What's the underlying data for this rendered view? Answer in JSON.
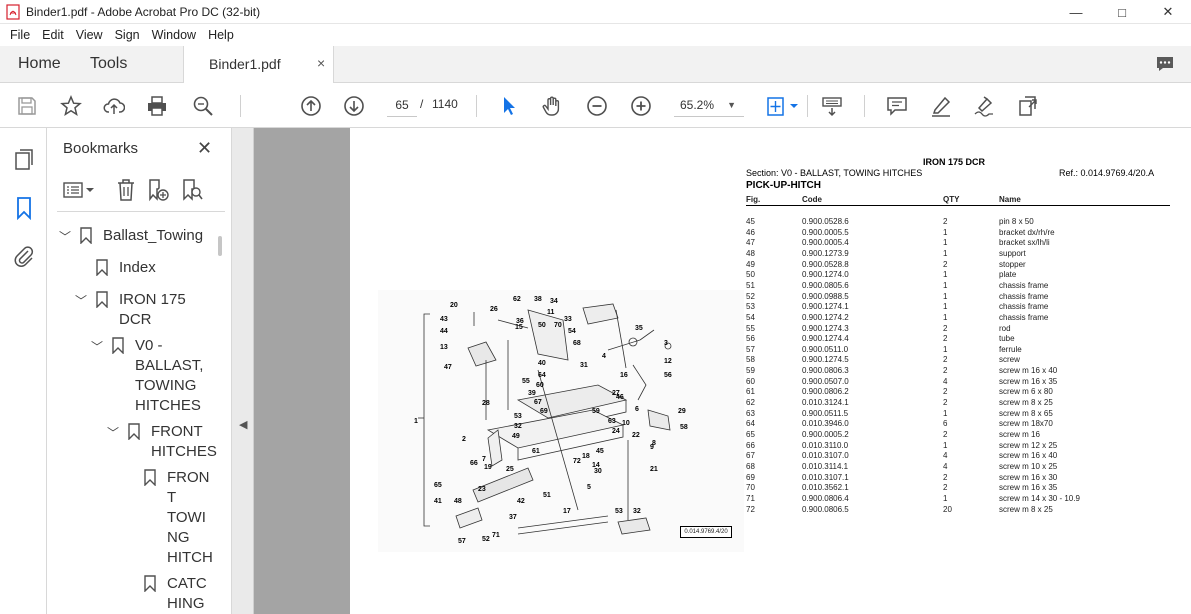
{
  "window": {
    "title": "Binder1.pdf - Adobe Acrobat Pro DC (32-bit)",
    "controls": [
      "—",
      "□",
      "✕"
    ]
  },
  "menu": [
    "File",
    "Edit",
    "View",
    "Sign",
    "Window",
    "Help"
  ],
  "tabs": {
    "home": "Home",
    "tools": "Tools",
    "document": "Binder1.pdf",
    "close": "×"
  },
  "toolbar": {
    "page_current": "65",
    "page_separator": "/",
    "page_total": "1140",
    "zoom": "65.2%"
  },
  "bookmarks": {
    "title": "Bookmarks",
    "close": "✕",
    "items": [
      {
        "label": "Ballast_Towing"
      },
      {
        "label": "Index"
      },
      {
        "label": "IRON 175 DCR"
      },
      {
        "label": "V0 - BALLAST, TOWING HITCHES"
      },
      {
        "label": "FRONT HITCHES"
      },
      {
        "label": "FRONT TOWING HITCH"
      },
      {
        "label": "CATCHING"
      }
    ],
    "lines": {
      "ballast": "Ballast_Towing",
      "index": "Index",
      "iron1": "IRON 175",
      "iron2": "DCR",
      "v0_1": "V0 -",
      "v0_2": "BALLAST,",
      "v0_3": "TOWING",
      "v0_4": "HITCHES",
      "front1": "FRONT",
      "front2": "HITCHES",
      "ft1": "FRON",
      "ft2": "T",
      "ft3": "TOWI",
      "ft4": "NG",
      "ft5": "HITCH",
      "c1": "CATC",
      "c2": "HING"
    }
  },
  "document": {
    "model": "IRON 175 DCR",
    "section": "Section: V0 - BALLAST, TOWING HITCHES",
    "ref": "Ref.: 0.014.9769.4/20.A",
    "heading": "PICK-UP-HITCH",
    "columns": {
      "fig": "Fig.",
      "code": "Code",
      "qty": "QTY",
      "name": "Name"
    },
    "parts": [
      {
        "fig": "45",
        "code": "0.900.0528.6",
        "qty": "2",
        "name": "pin 8 x 50"
      },
      {
        "fig": "46",
        "code": "0.900.0005.5",
        "qty": "1",
        "name": "bracket dx/rh/re"
      },
      {
        "fig": "47",
        "code": "0.900.0005.4",
        "qty": "1",
        "name": "bracket sx/lh/li"
      },
      {
        "fig": "48",
        "code": "0.900.1273.9",
        "qty": "1",
        "name": "support"
      },
      {
        "fig": "49",
        "code": "0.900.0528.8",
        "qty": "2",
        "name": "stopper"
      },
      {
        "fig": "50",
        "code": "0.900.1274.0",
        "qty": "1",
        "name": "plate"
      },
      {
        "fig": "51",
        "code": "0.900.0805.6",
        "qty": "1",
        "name": "chassis frame"
      },
      {
        "fig": "52",
        "code": "0.900.0988.5",
        "qty": "1",
        "name": "chassis frame"
      },
      {
        "fig": "53",
        "code": "0.900.1274.1",
        "qty": "1",
        "name": "chassis frame"
      },
      {
        "fig": "54",
        "code": "0.900.1274.2",
        "qty": "1",
        "name": "chassis frame"
      },
      {
        "fig": "55",
        "code": "0.900.1274.3",
        "qty": "2",
        "name": "rod"
      },
      {
        "fig": "56",
        "code": "0.900.1274.4",
        "qty": "2",
        "name": "tube"
      },
      {
        "fig": "57",
        "code": "0.900.0511.0",
        "qty": "1",
        "name": "ferrule"
      },
      {
        "fig": "58",
        "code": "0.900.1274.5",
        "qty": "2",
        "name": "screw"
      },
      {
        "fig": "59",
        "code": "0.900.0806.3",
        "qty": "2",
        "name": "screw m 16 x 40"
      },
      {
        "fig": "60",
        "code": "0.900.0507.0",
        "qty": "4",
        "name": "screw m 16 x 35"
      },
      {
        "fig": "61",
        "code": "0.900.0806.2",
        "qty": "2",
        "name": "screw m 6 x 80"
      },
      {
        "fig": "62",
        "code": "0.010.3124.1",
        "qty": "2",
        "name": "screw m 8 x 25"
      },
      {
        "fig": "63",
        "code": "0.900.0511.5",
        "qty": "1",
        "name": "screw m 8 x 65"
      },
      {
        "fig": "64",
        "code": "0.010.3946.0",
        "qty": "6",
        "name": "screw m 18x70"
      },
      {
        "fig": "65",
        "code": "0.900.0005.2",
        "qty": "2",
        "name": "screw m 16"
      },
      {
        "fig": "66",
        "code": "0.010.3110.0",
        "qty": "1",
        "name": "screw m 12 x 25"
      },
      {
        "fig": "67",
        "code": "0.010.3107.0",
        "qty": "4",
        "name": "screw m 16 x 40"
      },
      {
        "fig": "68",
        "code": "0.010.3114.1",
        "qty": "4",
        "name": "screw m 10 x 25"
      },
      {
        "fig": "69",
        "code": "0.010.3107.1",
        "qty": "2",
        "name": "screw m 16 x 30"
      },
      {
        "fig": "70",
        "code": "0.010.3562.1",
        "qty": "2",
        "name": "screw m 16 x 35"
      },
      {
        "fig": "71",
        "code": "0.900.0806.4",
        "qty": "1",
        "name": "screw m 14 x 30 - 10.9"
      },
      {
        "fig": "72",
        "code": "0.900.0806.5",
        "qty": "20",
        "name": "screw m 8 x 25"
      }
    ],
    "diagram_ref": "0.014.9769.4/20",
    "diagram_labels": [
      "20",
      "26",
      "62",
      "38",
      "34",
      "11",
      "33",
      "43",
      "44",
      "15",
      "50",
      "70",
      "54",
      "35",
      "36",
      "13",
      "68",
      "3",
      "47",
      "40",
      "64",
      "31",
      "4",
      "16",
      "12",
      "56",
      "55",
      "60",
      "39",
      "67",
      "69",
      "59",
      "27",
      "28",
      "46",
      "29",
      "53",
      "32",
      "63",
      "24",
      "58",
      "49",
      "61",
      "72",
      "18",
      "45",
      "22",
      "8",
      "2",
      "66",
      "19",
      "23",
      "25",
      "7",
      "21",
      "65",
      "41",
      "48",
      "42",
      "51",
      "5",
      "57",
      "52",
      "71",
      "37",
      "17",
      "53b",
      "32b",
      "1",
      "6",
      "9",
      "14",
      "10",
      "30"
    ]
  },
  "colors": {
    "accent_blue": "#1473e6",
    "toolbar_icon": "#505050",
    "acrobat_red": "#d6202d",
    "viewer_gray": "#a4a4a4"
  }
}
